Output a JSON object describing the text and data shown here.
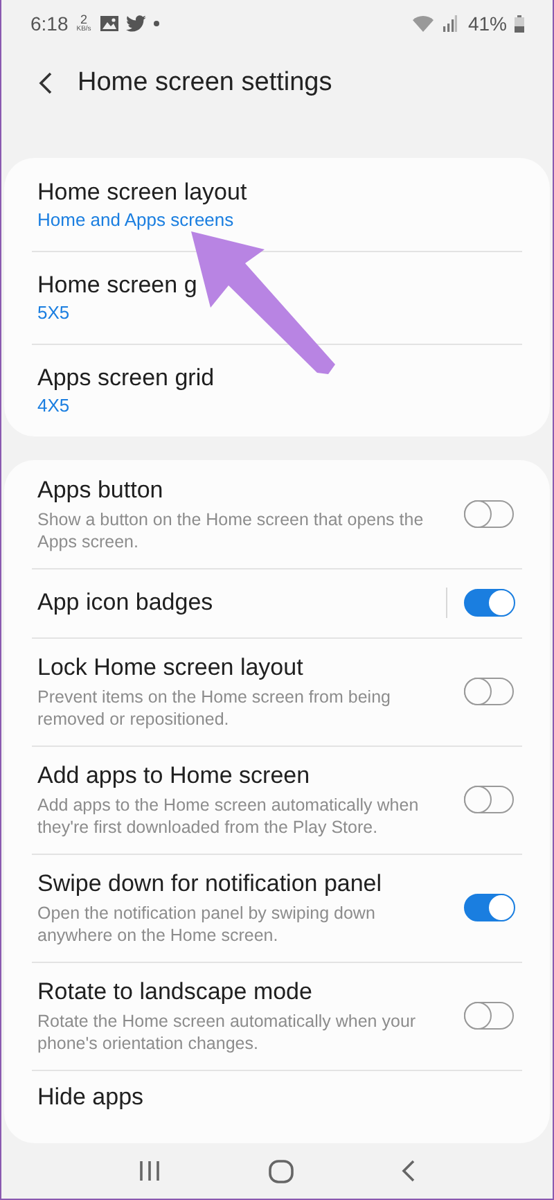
{
  "status_bar": {
    "time": "6:18",
    "data_speed": "2",
    "data_unit": "KB/s",
    "battery": "41%"
  },
  "header": {
    "title": "Home screen settings"
  },
  "layout_card": {
    "items": [
      {
        "title": "Home screen layout",
        "value": "Home and Apps screens"
      },
      {
        "title": "Home screen g",
        "value": "5X5"
      },
      {
        "title": "Apps screen grid",
        "value": "4X5"
      }
    ]
  },
  "settings": {
    "items": [
      {
        "kind": "switch",
        "title": "Apps button",
        "description": "Show a button on the Home screen that opens the Apps screen.",
        "on": false
      },
      {
        "kind": "split_switch",
        "title": "App icon badges",
        "on": true
      },
      {
        "kind": "switch",
        "title": "Lock Home screen layout",
        "description": "Prevent items on the Home screen from being removed or repositioned.",
        "on": false
      },
      {
        "kind": "switch",
        "title": "Add apps to Home screen",
        "description": "Add apps to the Home screen automatically when they're first downloaded from the Play Store.",
        "on": false
      },
      {
        "kind": "switch",
        "title": "Swipe down for notification panel",
        "description": "Open the notification panel by swiping down anywhere on the Home screen.",
        "on": true
      },
      {
        "kind": "switch",
        "title": "Rotate to landscape mode",
        "description": "Rotate the Home screen automatically when your phone's orientation changes.",
        "on": false
      },
      {
        "kind": "link",
        "title": "Hide apps"
      }
    ]
  }
}
